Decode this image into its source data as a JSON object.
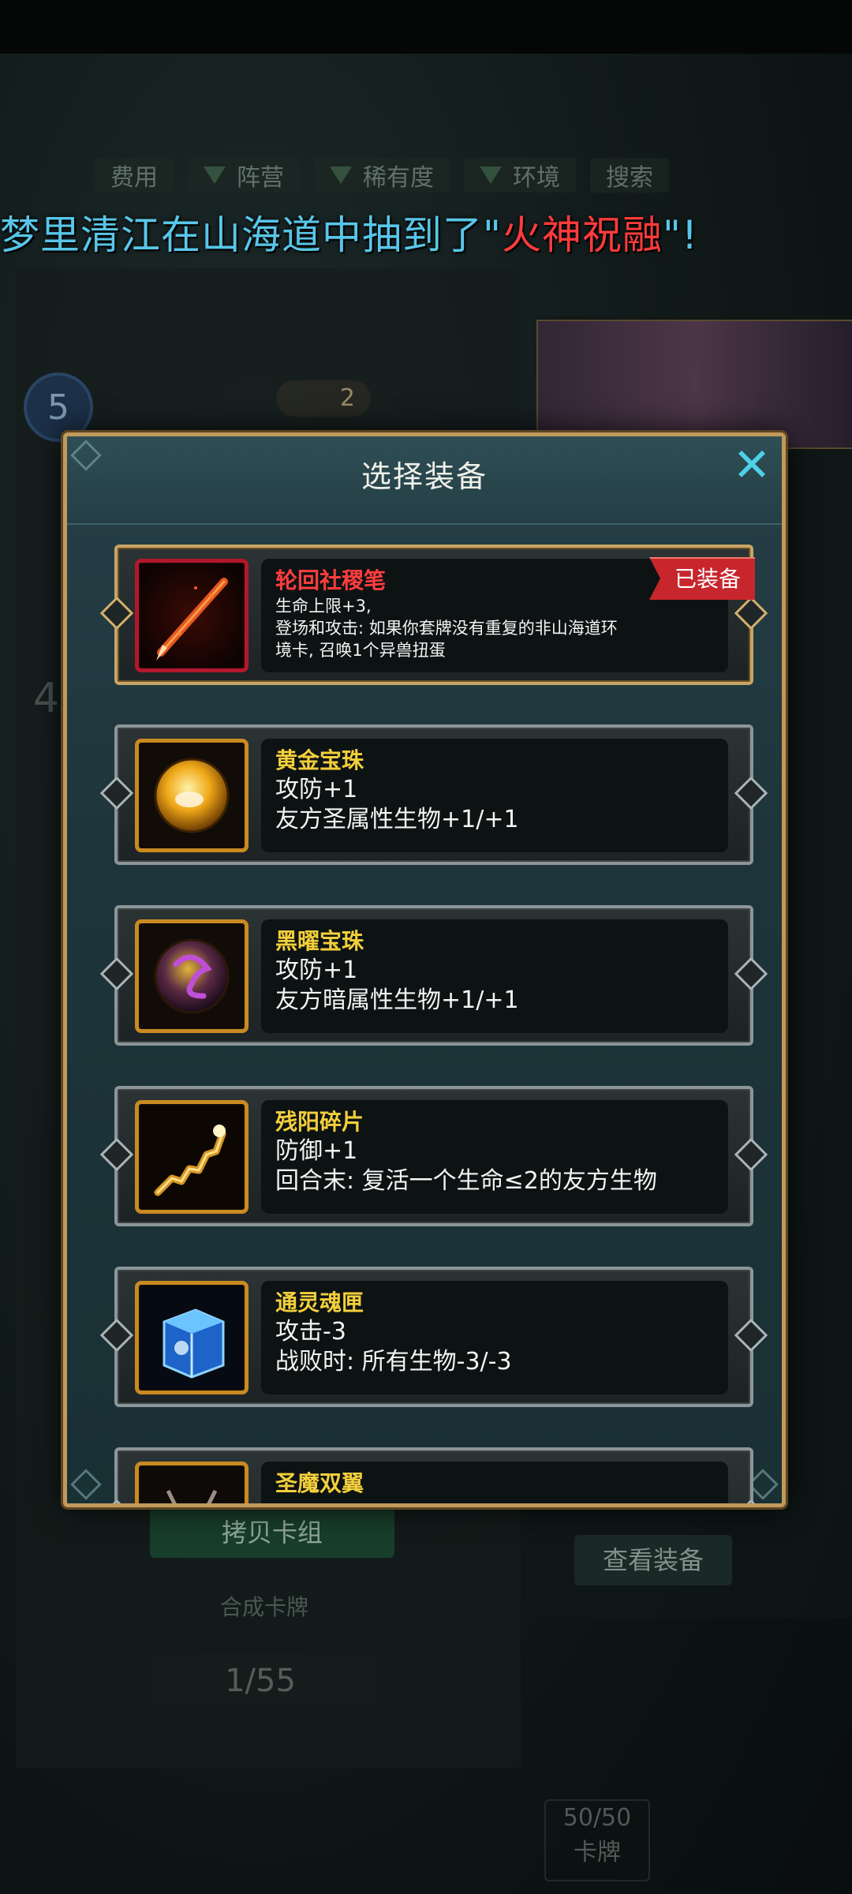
{
  "background": {
    "filters": [
      "费用",
      "阵营",
      "稀有度",
      "环境",
      "搜索"
    ],
    "broadcast": {
      "prefix": "梦里清江在山海道中抽到了\"",
      "highlight": "火神祝融",
      "suffix": "\"!"
    },
    "cost_badge": "5",
    "pill_value": "2",
    "copy_deck_button": "拷贝卡组",
    "view_equipment_button": "查看装备",
    "merge_label": "合成卡牌",
    "card_progress": "1/55",
    "deck_count": "50/50",
    "deck_label": "卡牌",
    "side_number": "4"
  },
  "modal": {
    "title": "选择装备",
    "close_symbol": "✕",
    "items": [
      {
        "name": "轮回社稷笔",
        "equipped": true,
        "badge": "已装备",
        "lines": [
          "生命上限+3,",
          "登场和攻击: 如果你套牌没有重复的非山海道环",
          "境卡, 召唤1个异兽扭蛋"
        ],
        "icon": "brush-icon"
      },
      {
        "name": "黄金宝珠",
        "equipped": false,
        "lines": [
          "攻防+1",
          "友方圣属性生物+1/+1"
        ],
        "icon": "golden-orb-icon"
      },
      {
        "name": "黑曜宝珠",
        "equipped": false,
        "lines": [
          "攻防+1",
          "友方暗属性生物+1/+1"
        ],
        "icon": "obsidian-orb-icon"
      },
      {
        "name": "残阳碎片",
        "equipped": false,
        "lines": [
          "防御+1",
          "回合末: 复活一个生命≤2的友方生物"
        ],
        "icon": "sun-fragment-icon"
      },
      {
        "name": "通灵魂匣",
        "equipped": false,
        "lines": [
          "攻击-3",
          "战败时: 所有生物-3/-3"
        ],
        "icon": "soul-box-icon"
      },
      {
        "name": "圣魔双翼",
        "equipped": false,
        "lines": [],
        "icon": "wings-icon"
      }
    ]
  },
  "colors": {
    "accent": "#4ed1e8",
    "equipped_name": "#ff3d3d",
    "item_name": "#f2cf3b",
    "badge": "#c7262c",
    "frame_gold": "#c19a5b"
  }
}
